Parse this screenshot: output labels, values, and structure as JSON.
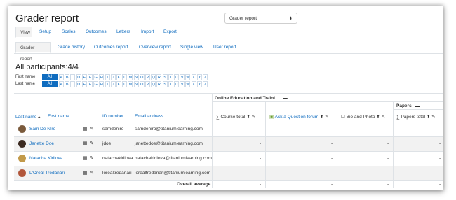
{
  "page": {
    "title": "Grader report",
    "subtitle": "All participants:4/4"
  },
  "report_select": {
    "value": "Grader report"
  },
  "tabs": [
    "View",
    "Setup",
    "Scales",
    "Outcomes",
    "Letters",
    "Import",
    "Export"
  ],
  "subtabs": [
    "Grader report",
    "Grade history",
    "Outcomes report",
    "Overview report",
    "Single view",
    "User report"
  ],
  "initials": {
    "first_label": "First name",
    "last_label": "Last name",
    "all": "All",
    "letters": [
      "A",
      "B",
      "C",
      "D",
      "E",
      "F",
      "G",
      "H",
      "I",
      "J",
      "K",
      "L",
      "M",
      "N",
      "O",
      "P",
      "Q",
      "R",
      "S",
      "T",
      "U",
      "V",
      "W",
      "X",
      "Y",
      "Z"
    ]
  },
  "table": {
    "category1": "Online Education and Traini…",
    "category2": "Papers",
    "headers": {
      "last_name": "Last name",
      "first_name": "First name",
      "id_number": "ID number",
      "email": "Email address",
      "course_total": "Course total",
      "ask_forum": "Ask a Question forum",
      "bio_photo": "Bio and Photo",
      "papers_total": "Papers total"
    },
    "rows": [
      {
        "name": "Sam De Niro",
        "id": "samdeniro",
        "email": "samdeniro@titaniumlearning.com",
        "course_total": "-",
        "ask": "-",
        "bio": "-",
        "papers": "-"
      },
      {
        "name": "Janette Doe",
        "id": "jdoe",
        "email": "janettedoe@titaniumlearning.com",
        "course_total": "-",
        "ask": "-",
        "bio": "-",
        "papers": "-"
      },
      {
        "name": "Natacha Kirilova",
        "id": "natachakirilova",
        "email": "natachakirilova@titaniumlearning.com",
        "course_total": "-",
        "ask": "-",
        "bio": "-",
        "papers": "-"
      },
      {
        "name": "L'Oreal Tredanari",
        "id": "lorealtredanari",
        "email": "lorealtredanari@titaniumlearning.com",
        "course_total": "-",
        "ask": "-",
        "bio": "-",
        "papers": "-"
      }
    ],
    "overall_label": "Overall average",
    "overall": {
      "course_total": "-",
      "ask": "-",
      "bio": "-",
      "papers": "-"
    }
  },
  "colors": {
    "link": "#0f6cbf",
    "active_all": "#0f6cbf",
    "stripe": "#f2f2f2"
  }
}
